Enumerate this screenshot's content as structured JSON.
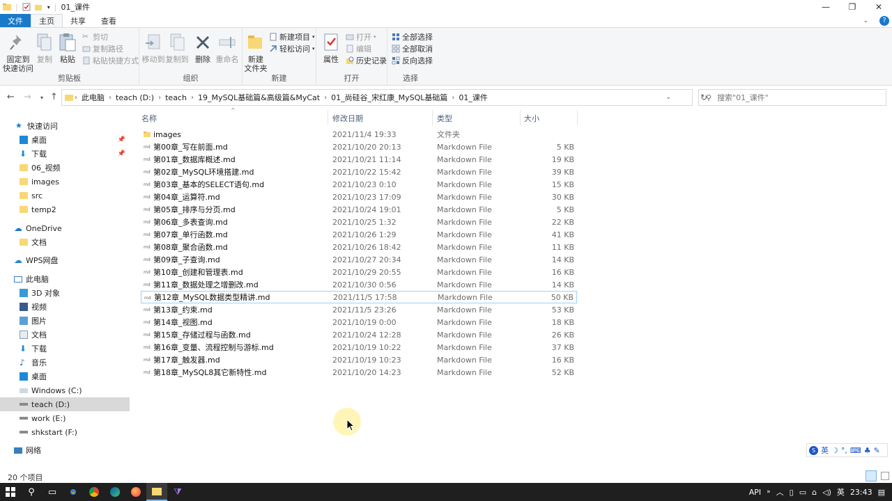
{
  "window": {
    "title": "01_课件"
  },
  "tabs": [
    {
      "label": "文件"
    },
    {
      "label": "主页"
    },
    {
      "label": "共享"
    },
    {
      "label": "查看"
    }
  ],
  "ribbon": {
    "clipboard": {
      "label": "剪贴板",
      "pin": "固定到\n快速访问",
      "copy": "复制",
      "paste": "粘贴",
      "cut": "剪切",
      "copy_path": "复制路径",
      "paste_shortcut": "粘贴快捷方式"
    },
    "organize": {
      "label": "组织",
      "move_to": "移动到",
      "copy_to": "复制到",
      "delete": "删除",
      "rename": "重命名"
    },
    "new": {
      "label": "新建",
      "new_folder": "新建\n文件夹",
      "new_item": "新建项目",
      "easy_access": "轻松访问"
    },
    "open": {
      "label": "打开",
      "properties": "属性",
      "open": "打开",
      "edit": "编辑",
      "history": "历史记录"
    },
    "select": {
      "label": "选择",
      "select_all": "全部选择",
      "select_none": "全部取消",
      "invert": "反向选择"
    }
  },
  "address": {
    "crumbs": [
      "此电脑",
      "teach (D:)",
      "teach",
      "19_MySQL基础篇&高级篇&MyCat",
      "01_尚硅谷_宋红康_MySQL基础篇",
      "01_课件"
    ],
    "search_placeholder": "搜索\"01_课件\""
  },
  "nav": {
    "quick_access": "快速访问",
    "quick_items": [
      "桌面",
      "下载",
      "06_视频",
      "images",
      "src",
      "temp2"
    ],
    "onedrive": "OneDrive",
    "onedrive_items": [
      "文档"
    ],
    "wps": "WPS网盘",
    "this_pc": "此电脑",
    "pc_items": [
      "3D 对象",
      "视频",
      "图片",
      "文档",
      "下载",
      "音乐",
      "桌面",
      "Windows (C:)",
      "teach (D:)",
      "work (E:)",
      "shkstart (F:)"
    ],
    "network": "网络"
  },
  "columns": {
    "name": "名称",
    "date": "修改日期",
    "type": "类型",
    "size": "大小"
  },
  "files": [
    {
      "name": "images",
      "date": "2021/11/4 19:33",
      "type": "文件夹",
      "size": ""
    },
    {
      "name": "第00章_写在前面.md",
      "date": "2021/10/20 20:13",
      "type": "Markdown File",
      "size": "5 KB"
    },
    {
      "name": "第01章_数据库概述.md",
      "date": "2021/10/21 11:14",
      "type": "Markdown File",
      "size": "19 KB"
    },
    {
      "name": "第02章_MySQL环境搭建.md",
      "date": "2021/10/22 15:42",
      "type": "Markdown File",
      "size": "39 KB"
    },
    {
      "name": "第03章_基本的SELECT语句.md",
      "date": "2021/10/23 0:10",
      "type": "Markdown File",
      "size": "15 KB"
    },
    {
      "name": "第04章_运算符.md",
      "date": "2021/10/23 17:09",
      "type": "Markdown File",
      "size": "30 KB"
    },
    {
      "name": "第05章_排序与分页.md",
      "date": "2021/10/24 19:01",
      "type": "Markdown File",
      "size": "5 KB"
    },
    {
      "name": "第06章_多表查询.md",
      "date": "2021/10/25 1:32",
      "type": "Markdown File",
      "size": "22 KB"
    },
    {
      "name": "第07章_单行函数.md",
      "date": "2021/10/26 1:29",
      "type": "Markdown File",
      "size": "41 KB"
    },
    {
      "name": "第08章_聚合函数.md",
      "date": "2021/10/26 18:42",
      "type": "Markdown File",
      "size": "11 KB"
    },
    {
      "name": "第09章_子查询.md",
      "date": "2021/10/27 20:34",
      "type": "Markdown File",
      "size": "14 KB"
    },
    {
      "name": "第10章_创建和管理表.md",
      "date": "2021/10/29 20:55",
      "type": "Markdown File",
      "size": "16 KB"
    },
    {
      "name": "第11章_数据处理之增删改.md",
      "date": "2021/10/30 0:56",
      "type": "Markdown File",
      "size": "14 KB"
    },
    {
      "name": "第12章_MySQL数据类型精讲.md",
      "date": "2021/11/5 17:58",
      "type": "Markdown File",
      "size": "50 KB"
    },
    {
      "name": "第13章_约束.md",
      "date": "2021/11/5 23:26",
      "type": "Markdown File",
      "size": "53 KB"
    },
    {
      "name": "第14章_视图.md",
      "date": "2021/10/19 0:00",
      "type": "Markdown File",
      "size": "18 KB"
    },
    {
      "name": "第15章_存储过程与函数.md",
      "date": "2021/10/24 12:28",
      "type": "Markdown File",
      "size": "26 KB"
    },
    {
      "name": "第16章_变量、流程控制与游标.md",
      "date": "2021/10/19 10:22",
      "type": "Markdown File",
      "size": "37 KB"
    },
    {
      "name": "第17章_触发器.md",
      "date": "2021/10/19 10:23",
      "type": "Markdown File",
      "size": "16 KB"
    },
    {
      "name": "第18章_MySQL8其它新特性.md",
      "date": "2021/10/20 14:23",
      "type": "Markdown File",
      "size": "52 KB"
    }
  ],
  "status": {
    "count": "20 个项目"
  },
  "taskbar": {
    "api": "API",
    "ime_lang": "英",
    "clock": "23:43"
  },
  "ime_bar": {
    "lang": "英"
  },
  "colors": {
    "accent": "#1979ca",
    "selection": "#cce8ff",
    "folder": "#f8d775"
  }
}
